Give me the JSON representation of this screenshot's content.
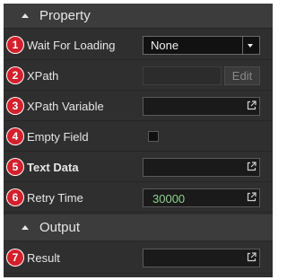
{
  "property_section": {
    "title": "Property"
  },
  "output_section": {
    "title": "Output"
  },
  "rows": {
    "wait_for_loading": {
      "badge": "1",
      "label": "Wait For Loading",
      "value": "None"
    },
    "xpath": {
      "badge": "2",
      "label": "XPath",
      "value": "",
      "edit_label": "Edit"
    },
    "xpath_variable": {
      "badge": "3",
      "label": "XPath Variable",
      "value": ""
    },
    "empty_field": {
      "badge": "4",
      "label": "Empty Field",
      "checked": false
    },
    "text_data": {
      "badge": "5",
      "label": "Text Data",
      "value": ""
    },
    "retry_time": {
      "badge": "6",
      "label": "Retry Time",
      "value": "30000"
    },
    "result": {
      "badge": "7",
      "label": "Result",
      "value": ""
    }
  },
  "colors": {
    "badge": "#d3202c",
    "panel_bg": "#2f2f2f",
    "header_bg": "#3c3c3c",
    "retry_value": "#8ed18e"
  },
  "icons": {
    "section_caret": "caret-up-icon",
    "field_action": "open-external-icon",
    "dropdown": "chevron-down-icon"
  }
}
